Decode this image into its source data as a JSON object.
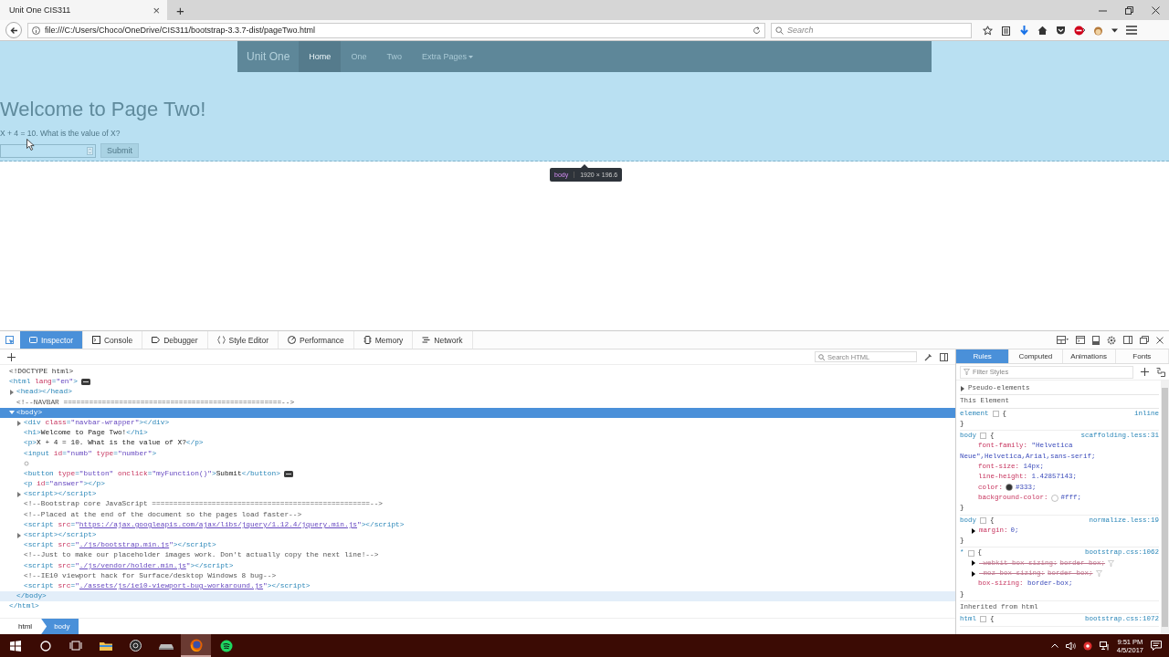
{
  "browser": {
    "tab": {
      "title": "Unit One CIS311",
      "close": "×"
    },
    "new_tab": "+",
    "url": "file:///C:/Users/Choco/OneDrive/CIS311/bootstrap-3.3.7-dist/pageTwo.html",
    "search": {
      "placeholder": "Search"
    }
  },
  "page": {
    "navbar": {
      "brand": "Unit One",
      "items": [
        {
          "label": "Home",
          "selected": true,
          "dropdown": false
        },
        {
          "label": "One",
          "selected": false,
          "dropdown": false
        },
        {
          "label": "Two",
          "selected": false,
          "dropdown": false
        },
        {
          "label": "Extra Pages",
          "selected": false,
          "dropdown": true
        }
      ]
    },
    "heading": "Welcome to Page Two!",
    "question": "X + 4 = 10. What is the value of X?",
    "submit": "Submit",
    "tooltip": {
      "tag": "body",
      "size": "1920 × 196.6"
    }
  },
  "devtools": {
    "tabs": [
      {
        "label": "Inspector",
        "selected": true
      },
      {
        "label": "Console",
        "selected": false
      },
      {
        "label": "Debugger",
        "selected": false
      },
      {
        "label": "Style Editor",
        "selected": false
      },
      {
        "label": "Performance",
        "selected": false
      },
      {
        "label": "Memory",
        "selected": false
      },
      {
        "label": "Network",
        "selected": false
      }
    ],
    "search_html": {
      "placeholder": "Search HTML"
    },
    "markup": [
      {
        "kind": "node",
        "selected": false,
        "event": false,
        "parts": [
          {
            "kind": "doctype",
            "text": "<!DOCTYPE html>"
          }
        ]
      },
      {
        "kind": "node",
        "selected": false,
        "event": true,
        "parts": [
          {
            "kind": "tag",
            "text": "<html"
          },
          {
            "kind": "attr",
            "text": " lang"
          },
          {
            "kind": "tag",
            "text": "="
          },
          {
            "kind": "val",
            "text": "\"en\""
          },
          {
            "kind": "tag",
            "text": ">"
          }
        ],
        "closing": [
          {
            "kind": "tag",
            "text": "</html>"
          }
        ],
        "children": [
          {
            "kind": "node",
            "expanded": false,
            "selected": false,
            "event": false,
            "parts": [
              {
                "kind": "tag",
                "text": "<head></head>"
              }
            ]
          },
          {
            "kind": "node",
            "selected": false,
            "event": false,
            "parts": [
              {
                "kind": "comment",
                "text": "<!--NAVBAR ===================================================-->"
              }
            ]
          },
          {
            "kind": "node",
            "expanded": true,
            "selected": true,
            "event": false,
            "parts": [
              {
                "kind": "tag",
                "text": "<body>"
              }
            ],
            "closing": [
              {
                "kind": "tag",
                "text": "</body>"
              }
            ],
            "children": [
              {
                "kind": "node",
                "expanded": false,
                "selected": false,
                "event": false,
                "parts": [
                  {
                    "kind": "tag",
                    "text": "<div"
                  },
                  {
                    "kind": "attr",
                    "text": " class"
                  },
                  {
                    "kind": "tag",
                    "text": "="
                  },
                  {
                    "kind": "val",
                    "text": "\"navbar-wrapper\""
                  },
                  {
                    "kind": "tag",
                    "text": "></div>"
                  }
                ]
              },
              {
                "kind": "node",
                "selected": false,
                "event": false,
                "parts": [
                  {
                    "kind": "tag",
                    "text": "<h1>"
                  },
                  {
                    "kind": "text",
                    "text": "Welcome to Page Two!"
                  },
                  {
                    "kind": "tag",
                    "text": "</h1>"
                  }
                ]
              },
              {
                "kind": "node",
                "selected": false,
                "event": false,
                "parts": [
                  {
                    "kind": "tag",
                    "text": "<p>"
                  },
                  {
                    "kind": "text",
                    "text": "X + 4 = 10. What is the value of X?"
                  },
                  {
                    "kind": "tag",
                    "text": "</p>"
                  }
                ]
              },
              {
                "kind": "node",
                "selected": false,
                "event": false,
                "parts": [
                  {
                    "kind": "tag",
                    "text": "<input"
                  },
                  {
                    "kind": "attr",
                    "text": " id"
                  },
                  {
                    "kind": "tag",
                    "text": "="
                  },
                  {
                    "kind": "val",
                    "text": "\"numb\""
                  },
                  {
                    "kind": "attr",
                    "text": " type"
                  },
                  {
                    "kind": "tag",
                    "text": "="
                  },
                  {
                    "kind": "val",
                    "text": "\"number\""
                  },
                  {
                    "kind": "tag",
                    "text": ">"
                  }
                ]
              },
              {
                "kind": "whitespace",
                "selected": false,
                "event": false
              },
              {
                "kind": "node",
                "selected": false,
                "event": true,
                "parts": [
                  {
                    "kind": "tag",
                    "text": "<button"
                  },
                  {
                    "kind": "attr",
                    "text": " type"
                  },
                  {
                    "kind": "tag",
                    "text": "="
                  },
                  {
                    "kind": "val",
                    "text": "\"button\""
                  },
                  {
                    "kind": "attr",
                    "text": " onclick"
                  },
                  {
                    "kind": "tag",
                    "text": "="
                  },
                  {
                    "kind": "val",
                    "text": "\"myFunction()\""
                  },
                  {
                    "kind": "tag",
                    "text": ">"
                  },
                  {
                    "kind": "text",
                    "text": "Submit"
                  },
                  {
                    "kind": "tag",
                    "text": "</button>"
                  }
                ]
              },
              {
                "kind": "node",
                "selected": false,
                "event": false,
                "parts": [
                  {
                    "kind": "tag",
                    "text": "<p"
                  },
                  {
                    "kind": "attr",
                    "text": " id"
                  },
                  {
                    "kind": "tag",
                    "text": "="
                  },
                  {
                    "kind": "val",
                    "text": "\"answer\""
                  },
                  {
                    "kind": "tag",
                    "text": "></p>"
                  }
                ]
              },
              {
                "kind": "node",
                "expanded": false,
                "selected": false,
                "event": false,
                "parts": [
                  {
                    "kind": "tag",
                    "text": "<script></script>"
                  }
                ]
              },
              {
                "kind": "node",
                "selected": false,
                "event": false,
                "parts": [
                  {
                    "kind": "comment",
                    "text": "<!--Bootstrap core JavaScript ===================================================-->"
                  }
                ]
              },
              {
                "kind": "node",
                "selected": false,
                "event": false,
                "parts": [
                  {
                    "kind": "comment",
                    "text": "<!--Placed at the end of the document so the pages load faster-->"
                  }
                ]
              },
              {
                "kind": "node",
                "selected": false,
                "event": false,
                "parts": [
                  {
                    "kind": "tag",
                    "text": "<script"
                  },
                  {
                    "kind": "attr",
                    "text": " src"
                  },
                  {
                    "kind": "tag",
                    "text": "="
                  },
                  {
                    "kind": "val",
                    "text": "\""
                  },
                  {
                    "kind": "link",
                    "text": "https://ajax.googleapis.com/ajax/libs/jquery/1.12.4/jquery.min.js"
                  },
                  {
                    "kind": "val",
                    "text": "\""
                  },
                  {
                    "kind": "tag",
                    "text": "></script>"
                  }
                ]
              },
              {
                "kind": "node",
                "expanded": false,
                "selected": false,
                "event": false,
                "parts": [
                  {
                    "kind": "tag",
                    "text": "<script></script>"
                  }
                ]
              },
              {
                "kind": "node",
                "selected": false,
                "event": false,
                "parts": [
                  {
                    "kind": "tag",
                    "text": "<script"
                  },
                  {
                    "kind": "attr",
                    "text": " src"
                  },
                  {
                    "kind": "tag",
                    "text": "="
                  },
                  {
                    "kind": "val",
                    "text": "\""
                  },
                  {
                    "kind": "link",
                    "text": "./js/bootstrap.min.js"
                  },
                  {
                    "kind": "val",
                    "text": "\""
                  },
                  {
                    "kind": "tag",
                    "text": "></script>"
                  }
                ]
              },
              {
                "kind": "node",
                "selected": false,
                "event": false,
                "parts": [
                  {
                    "kind": "comment",
                    "text": "<!--Just to make our placeholder images work. Don't actually copy the next line!-->"
                  }
                ]
              },
              {
                "kind": "node",
                "selected": false,
                "event": false,
                "parts": [
                  {
                    "kind": "tag",
                    "text": "<script"
                  },
                  {
                    "kind": "attr",
                    "text": " src"
                  },
                  {
                    "kind": "tag",
                    "text": "="
                  },
                  {
                    "kind": "val",
                    "text": "\""
                  },
                  {
                    "kind": "link",
                    "text": "./js/vendor/holder.min.js"
                  },
                  {
                    "kind": "val",
                    "text": "\""
                  },
                  {
                    "kind": "tag",
                    "text": "></script>"
                  }
                ]
              },
              {
                "kind": "node",
                "selected": false,
                "event": false,
                "parts": [
                  {
                    "kind": "comment",
                    "text": "<!--IE10 viewport hack for Surface/desktop Windows 8 bug-->"
                  }
                ]
              },
              {
                "kind": "node",
                "selected": false,
                "event": false,
                "parts": [
                  {
                    "kind": "tag",
                    "text": "<script"
                  },
                  {
                    "kind": "attr",
                    "text": " src"
                  },
                  {
                    "kind": "tag",
                    "text": "="
                  },
                  {
                    "kind": "val",
                    "text": "\""
                  },
                  {
                    "kind": "link",
                    "text": "./assets/js/ie10-viewport-bug-workaround.js"
                  },
                  {
                    "kind": "val",
                    "text": "\""
                  },
                  {
                    "kind": "tag",
                    "text": "></script>"
                  }
                ]
              }
            ]
          }
        ]
      }
    ],
    "breadcrumbs": [
      {
        "label": "html",
        "selected": false
      },
      {
        "label": "body",
        "selected": true
      }
    ],
    "sidebar_tabs": [
      {
        "label": "Rules",
        "selected": true
      },
      {
        "label": "Computed",
        "selected": false
      },
      {
        "label": "Animations",
        "selected": false
      },
      {
        "label": "Fonts",
        "selected": false
      }
    ],
    "filter": {
      "placeholder": "Filter Styles"
    },
    "rules": [
      {
        "kind": "section",
        "label": "Pseudo-elements",
        "expanded": false
      },
      {
        "kind": "header",
        "label": "This Element"
      },
      {
        "kind": "rule",
        "selector": "element",
        "open": "{",
        "source": "inline",
        "close": "}"
      },
      {
        "kind": "rule",
        "selector": "body",
        "open": "{",
        "source": "scaffolding.less:31",
        "close": "}",
        "decls": [
          {
            "name": "font-family:",
            "value": "\"Helvetica Neue\",Helvetica,Arial,sans-serif;",
            "overridden": false,
            "expandable": false
          },
          {
            "name": "font-size:",
            "value": "14px;",
            "overridden": false,
            "expandable": false
          },
          {
            "name": "line-height:",
            "value": "1.42857143;",
            "overridden": false,
            "expandable": false
          },
          {
            "name": "color:",
            "value": "#333;",
            "overridden": false,
            "expandable": false,
            "color": "#333333"
          },
          {
            "name": "background-color:",
            "value": "#fff;",
            "overridden": false,
            "expandable": false,
            "color": "#ffffff"
          }
        ]
      },
      {
        "kind": "rule",
        "selector": "body",
        "open": "{",
        "source": "normalize.less:19",
        "close": "}",
        "decls": [
          {
            "name": "margin:",
            "value": "0;",
            "overridden": false,
            "expandable": true
          }
        ]
      },
      {
        "kind": "rule",
        "selector": "*",
        "open": "{",
        "source": "bootstrap.css:1062",
        "close": "}",
        "decls": [
          {
            "name": "-webkit-box-sizing:",
            "value": "border-box;",
            "overridden": true,
            "expandable": true
          },
          {
            "name": "-moz-box-sizing:",
            "value": "border-box;",
            "overridden": true,
            "expandable": true
          },
          {
            "name": "box-sizing:",
            "value": "border-box;",
            "overridden": false,
            "expandable": false
          }
        ]
      },
      {
        "kind": "header",
        "label": "Inherited from html"
      },
      {
        "kind": "rule",
        "selector": "html",
        "open": "{",
        "source": "bootstrap.css:1072"
      }
    ]
  },
  "taskbar": {
    "time": "9:51 PM",
    "date": "4/5/2017"
  }
}
